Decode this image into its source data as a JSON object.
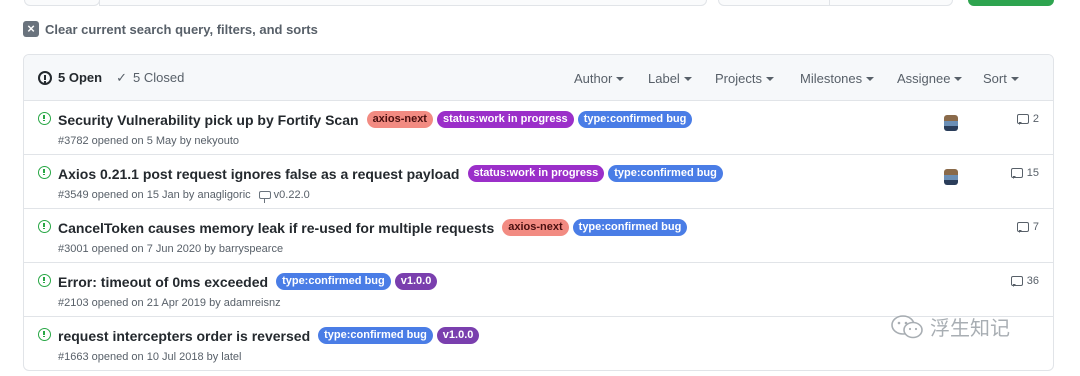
{
  "clear_search": {
    "label": "Clear current search query, filters, and sorts"
  },
  "header": {
    "open_label": "5 Open",
    "closed_label": "5 Closed",
    "filters": [
      "Author",
      "Label",
      "Projects",
      "Milestones",
      "Assignee",
      "Sort"
    ]
  },
  "issues": [
    {
      "title": "Security Vulnerability pick up by Fortify Scan",
      "labels": [
        {
          "text": "axios-next",
          "bg": "#f28b82",
          "fg": "#4a1010"
        },
        {
          "text": "status:work in progress",
          "bg": "#9b2fc9",
          "fg": "#ffffff"
        },
        {
          "text": "type:confirmed bug",
          "bg": "#4a7de6",
          "fg": "#ffffff"
        }
      ],
      "meta": "#3782 opened on 5 May by nekyouto",
      "milestone": "",
      "has_avatar": true,
      "comments": "2"
    },
    {
      "title": "Axios 0.21.1 post request ignores false as a request payload",
      "labels": [
        {
          "text": "status:work in progress",
          "bg": "#9b2fc9",
          "fg": "#ffffff"
        },
        {
          "text": "type:confirmed bug",
          "bg": "#4a7de6",
          "fg": "#ffffff"
        }
      ],
      "meta": "#3549 opened on 15 Jan by anagligoric",
      "milestone": "v0.22.0",
      "has_avatar": true,
      "comments": "15"
    },
    {
      "title": "CancelToken causes memory leak if re-used for multiple requests",
      "labels": [
        {
          "text": "axios-next",
          "bg": "#f28b82",
          "fg": "#4a1010"
        },
        {
          "text": "type:confirmed bug",
          "bg": "#4a7de6",
          "fg": "#ffffff"
        }
      ],
      "meta": "#3001 opened on 7 Jun 2020 by barryspearce",
      "milestone": "",
      "has_avatar": false,
      "comments": "7"
    },
    {
      "title": "Error: timeout of 0ms exceeded",
      "labels": [
        {
          "text": "type:confirmed bug",
          "bg": "#4a7de6",
          "fg": "#ffffff"
        },
        {
          "text": "v1.0.0",
          "bg": "#7a3fae",
          "fg": "#ffffff"
        }
      ],
      "meta": "#2103 opened on 21 Apr 2019 by adamreisnz",
      "milestone": "",
      "has_avatar": false,
      "comments": "36"
    },
    {
      "title": "request intercepters order is reversed",
      "labels": [
        {
          "text": "type:confirmed bug",
          "bg": "#4a7de6",
          "fg": "#ffffff"
        },
        {
          "text": "v1.0.0",
          "bg": "#7a3fae",
          "fg": "#ffffff"
        }
      ],
      "meta": "#1663 opened on 10 Jul 2018 by latel",
      "milestone": "",
      "has_avatar": false,
      "comments": ""
    }
  ],
  "watermark": {
    "text": "浮生知记",
    "icon": "wechat-icon"
  }
}
